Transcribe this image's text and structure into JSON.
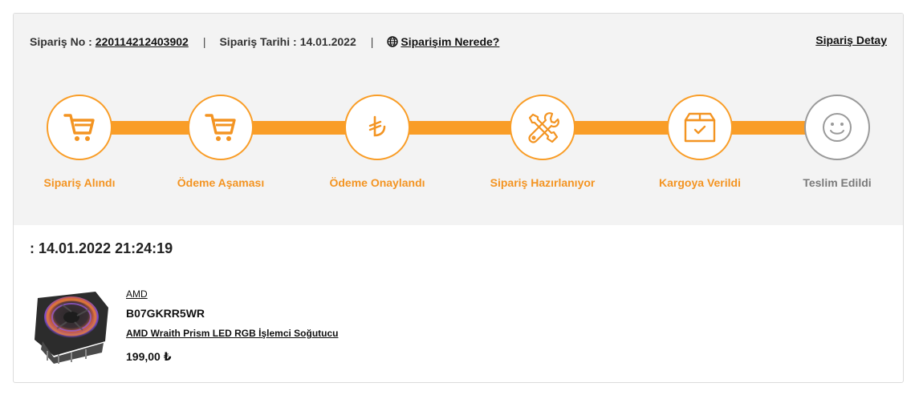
{
  "order": {
    "number_label": "Sipariş No :",
    "number": "220114212403902",
    "separator": "|",
    "date_label": "Sipariş Tarihi :",
    "date": "14.01.2022",
    "where_label": "Siparişim Nerede?",
    "detail_label": "Sipariş Detay"
  },
  "steps": [
    {
      "label": "Sipariş Alındı",
      "icon": "cart-icon",
      "status": "done"
    },
    {
      "label": "Ödeme Aşaması",
      "icon": "cart-icon",
      "status": "done"
    },
    {
      "label": "Ödeme Onaylandı",
      "icon": "lira-icon",
      "status": "done"
    },
    {
      "label": "Sipariş Hazırlanıyor",
      "icon": "tools-icon",
      "status": "done"
    },
    {
      "label": "Kargoya Verildi",
      "icon": "package-icon",
      "status": "done"
    },
    {
      "label": "Teslim Edildi",
      "icon": "smiley-icon",
      "status": "pending"
    }
  ],
  "shipment": {
    "datetime": ": 14.01.2022 21:24:19"
  },
  "product": {
    "brand": "AMD",
    "sku": "B07GKRR5WR",
    "name": "AMD Wraith Prism LED RGB İşlemci Soğutucu",
    "price": "199,00 ₺"
  },
  "colors": {
    "accent": "#f99d27",
    "accent_text": "#f39422",
    "pending": "#9a9a9a",
    "panel_bg": "#f3f3f3"
  }
}
